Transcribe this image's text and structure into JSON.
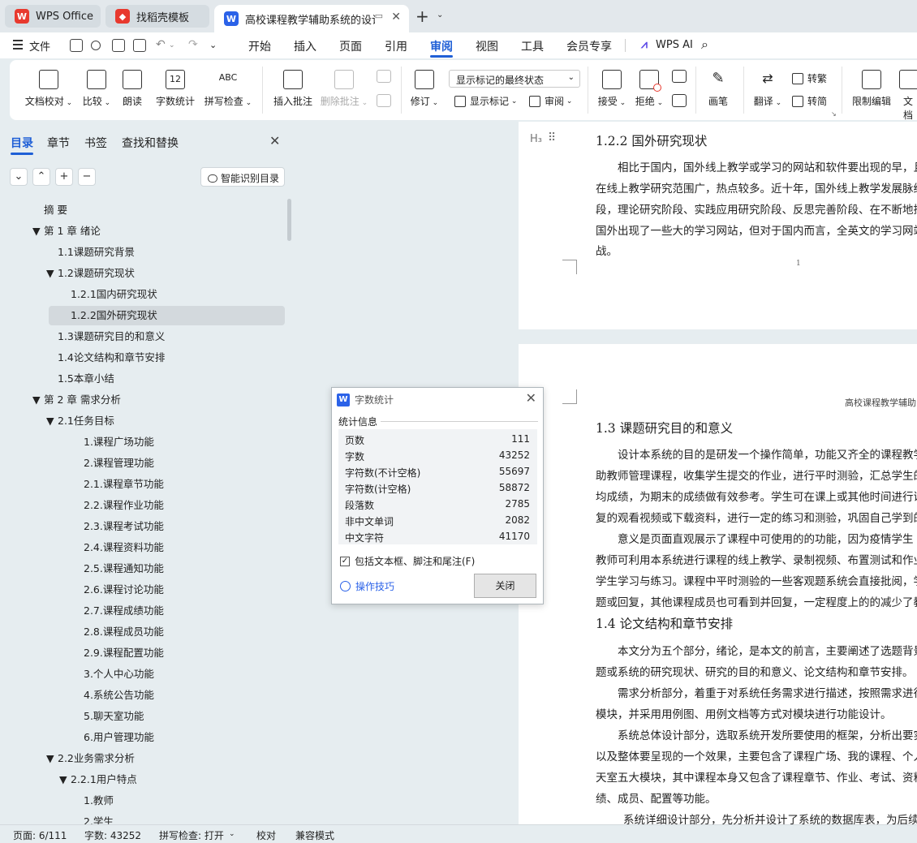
{
  "tabs": [
    {
      "label": "WPS Office",
      "icon": "wps-logo-icon",
      "color": "#e8392e"
    },
    {
      "label": "找稻壳模板",
      "icon": "docer-icon",
      "color": "#e8392e"
    },
    {
      "label": "高校课程教学辅助系统的设计与",
      "icon": "word-doc-icon",
      "color": "#2b62e8"
    }
  ],
  "menu": {
    "file": "文件",
    "items": [
      "开始",
      "插入",
      "页面",
      "引用",
      "审阅",
      "视图",
      "工具",
      "会员专享"
    ],
    "selected": "审阅",
    "ai": "WPS AI"
  },
  "ribbon": {
    "doc_check": "文档校对",
    "compare": "比较",
    "read_aloud": "朗读",
    "word_count": "字数统计",
    "word_count_icon_text": "12",
    "spell_check": "拼写检查",
    "spell_icon_text": "ABC",
    "insert_comment": "插入批注",
    "delete_comment": "删除批注",
    "revise": "修订",
    "markup_state": "显示标记的最终状态",
    "show_markup": "显示标记",
    "review": "审阅",
    "accept": "接受",
    "reject": "拒绝",
    "pen": "画笔",
    "translate": "翻译",
    "to_traditional": "转繁",
    "to_simplified": "转简",
    "restrict_edit": "限制编辑",
    "doc_more": "文档"
  },
  "nav": {
    "tabs": [
      "目录",
      "章节",
      "书签",
      "查找和替换"
    ],
    "ai_toc": "智能识别目录",
    "toc": [
      "摘 要",
      "第 1 章 绪论",
      "1.1课题研究背景",
      "1.2课题研究现状",
      "1.2.1国内研究现状",
      "1.2.2国外研究现状",
      "1.3课题研究目的和意义",
      "1.4论文结构和章节安排",
      "1.5本章小结",
      "第 2 章 需求分析",
      "2.1任务目标",
      "1.课程广场功能",
      "2.课程管理功能",
      "2.1.课程章节功能",
      "2.2.课程作业功能",
      "2.3.课程考试功能",
      "2.4.课程资料功能",
      "2.5.课程通知功能",
      "2.6.课程讨论功能",
      "2.7.课程成绩功能",
      "2.8.课程成员功能",
      "2.9.课程配置功能",
      "3.个人中心功能",
      "4.系统公告功能",
      "5.聊天室功能",
      "6.用户管理功能",
      "2.2业务需求分析",
      "2.2.1用户特点",
      "1.教师",
      "2.学生"
    ]
  },
  "doc": {
    "heading_mark": "H₃",
    "p1_heading": "1.2.2  国外研究现状",
    "p1_lines": [
      "相比于国内，国外线上教学或学习的网站和软件要出现的早，且",
      "在线上教学研究范围广，热点较多。近十年，国外线上教学发展脉络",
      "段，理论研究阶段、实践应用研究阶段、反思完善阶段、在不断地探",
      "国外出现了一些大的学习网站，但对于国内而言，全英文的学习网站",
      "战。"
    ],
    "page_number": "1",
    "header_text": "高校课程教学辅助",
    "h13": "1.3  课题研究目的和意义",
    "p13_lines": [
      "设计本系统的目的是研发一个操作简单，功能又齐全的课程教学",
      "助教师管理课程，收集学生提交的作业，进行平时测验，汇总学生的",
      "均成绩，为期末的成绩做有效参考。学生可在课上或其他时间进行课",
      "复的观看视频或下载资料，进行一定的练习和测验，巩固自己学到的",
      "意义是页面直观展示了课程中可使用的的功能，因为疫情学生",
      "教师可利用本系统进行课程的线上教学、录制视频、布置测试和作业",
      "学生学习与练习。课程中平时测验的一些客观题系统会直接批阅，学生",
      "题或回复，其他课程成员也可看到并回复，一定程度上的的减少了教师"
    ],
    "h14": "1.4  论文结构和章节安排",
    "p14_lines": [
      "本文分为五个部分，绪论，是本文的前言，主要阐述了选题背景",
      "题或系统的研究现状、研究的目的和意义、论文结构和章节安排。",
      "需求分析部分，着重于对系统任务需求进行描述，按照需求进行",
      "模块，并采用用例图、用例文档等方式对模块进行功能设计。",
      "系统总体设计部分，选取系统开发所要使用的框架，分析出要实",
      "以及整体要呈现的一个效果，主要包含了课程广场、我的课程、个人中",
      "天室五大模块，其中课程本身又包含了课程章节、作业、考试、资料",
      "绩、成员、配置等功能。",
      "系统详细设计部分，先分析并设计了系统的数据库表，为后续系统"
    ]
  },
  "dialog": {
    "title": "字数统计",
    "section": "统计信息",
    "rows": [
      {
        "label": "页数",
        "value": "111"
      },
      {
        "label": "字数",
        "value": "43252"
      },
      {
        "label": "字符数(不计空格)",
        "value": "55697"
      },
      {
        "label": "字符数(计空格)",
        "value": "58872"
      },
      {
        "label": "段落数",
        "value": "2785"
      },
      {
        "label": "非中文单词",
        "value": "2082"
      },
      {
        "label": "中文字符",
        "value": "41170"
      }
    ],
    "include_label": "包括文本框、脚注和尾注(F)",
    "tips": "操作技巧",
    "close": "关闭"
  },
  "status": {
    "page": "页面: 6/111",
    "words": "字数: 43252",
    "spell": "拼写检查: 打开",
    "proof": "校对",
    "compat": "兼容模式"
  },
  "colors": {
    "accent": "#1f5fd6",
    "wps_red": "#e8392e",
    "word_blue": "#2b62e8"
  }
}
